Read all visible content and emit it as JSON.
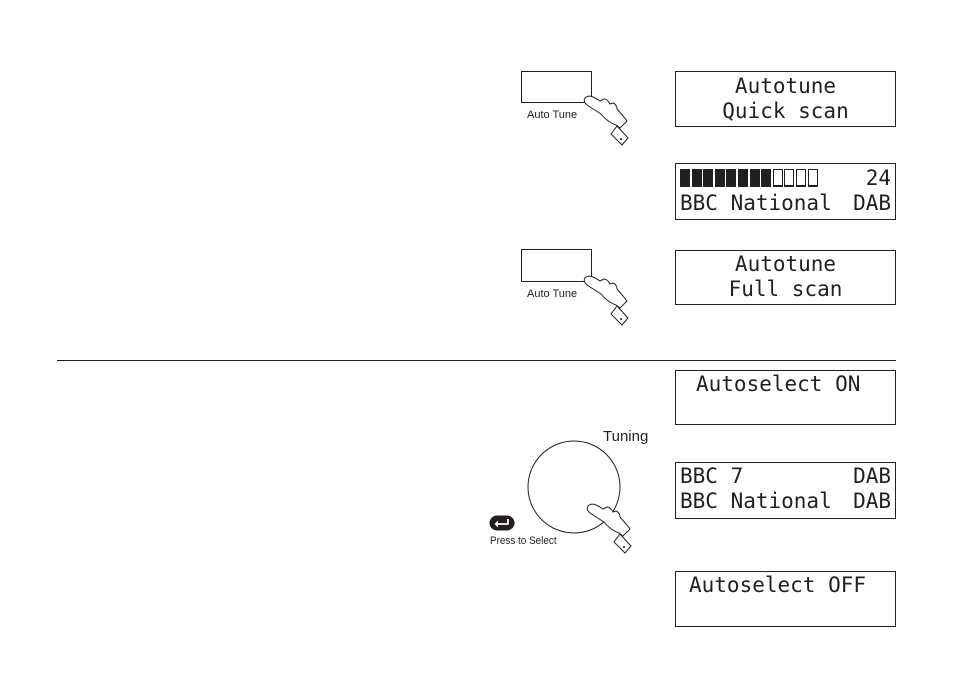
{
  "quick_scan": {
    "button_label": "Auto Tune",
    "display": {
      "line1": "Autotune",
      "line2": "Quick scan"
    }
  },
  "scan_progress": {
    "progress_filled_segments": 8,
    "progress_total_segments": 12,
    "station_count": "24",
    "line2_left": "BBC National",
    "line2_right": "DAB"
  },
  "full_scan": {
    "button_label": "Auto Tune",
    "display": {
      "line1": "Autotune",
      "line2": "Full scan"
    }
  },
  "autoselect_on": {
    "line1": "Autoselect ON"
  },
  "tuning": {
    "knob_label": "Tuning",
    "select_label": "Press to Select",
    "select_icon": "enter-return-icon"
  },
  "station_list": {
    "row1_left": "BBC 7",
    "row1_right": "DAB",
    "row2_left": "BBC National",
    "row2_right": "DAB"
  },
  "autoselect_off": {
    "line1": "Autoselect OFF"
  }
}
